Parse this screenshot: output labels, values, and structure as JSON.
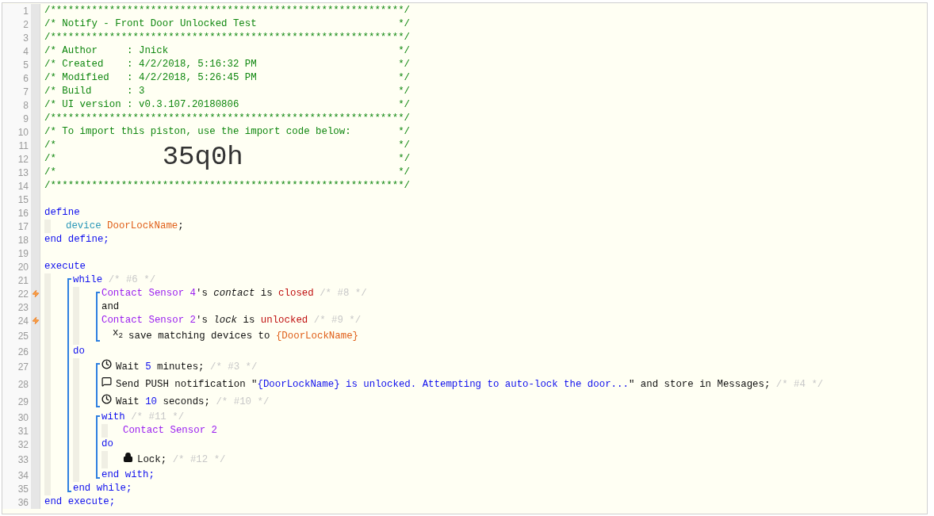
{
  "editor": {
    "lines": [
      {
        "kind": "code",
        "number": "1",
        "trigger": false,
        "tokens": [
          {
            "kind": "comment",
            "text": "/************************************************************/"
          }
        ]
      },
      {
        "kind": "box",
        "number": "2",
        "trigger": false,
        "tokens": [
          {
            "kind": "comment",
            "text": "/* Notify - Front Door Unlocked Test"
          },
          {
            "kind": "comment",
            "text": "*/"
          }
        ]
      },
      {
        "kind": "code",
        "number": "3",
        "trigger": false,
        "tokens": [
          {
            "kind": "comment",
            "text": "/************************************************************/"
          }
        ]
      },
      {
        "kind": "box",
        "number": "4",
        "trigger": false,
        "tokens": [
          {
            "kind": "comment",
            "text": "/* Author     : Jnick"
          },
          {
            "kind": "comment",
            "text": "*/"
          }
        ]
      },
      {
        "kind": "box",
        "number": "5",
        "trigger": false,
        "tokens": [
          {
            "kind": "comment",
            "text": "/* Created    : 4/2/2018, 5:16:32 PM"
          },
          {
            "kind": "comment",
            "text": "*/"
          }
        ]
      },
      {
        "kind": "box",
        "number": "6",
        "trigger": false,
        "tokens": [
          {
            "kind": "comment",
            "text": "/* Modified   : 4/2/2018, 5:26:45 PM"
          },
          {
            "kind": "comment",
            "text": "*/"
          }
        ]
      },
      {
        "kind": "box",
        "number": "7",
        "trigger": false,
        "tokens": [
          {
            "kind": "comment",
            "text": "/* Build      : 3"
          },
          {
            "kind": "comment",
            "text": "*/"
          }
        ]
      },
      {
        "kind": "box",
        "number": "8",
        "trigger": false,
        "tokens": [
          {
            "kind": "comment",
            "text": "/* UI version : v0.3.107.20180806"
          },
          {
            "kind": "comment",
            "text": "*/"
          }
        ]
      },
      {
        "kind": "code",
        "number": "9",
        "trigger": false,
        "tokens": [
          {
            "kind": "comment",
            "text": "/************************************************************/"
          }
        ]
      },
      {
        "kind": "box",
        "number": "10",
        "trigger": false,
        "tokens": [
          {
            "kind": "comment",
            "text": "/* To import this piston, use the import code below:"
          },
          {
            "kind": "comment",
            "text": "*/"
          }
        ]
      },
      {
        "kind": "box",
        "number": "11",
        "trigger": false,
        "tokens": [
          {
            "kind": "comment",
            "text": "/*"
          },
          {
            "kind": "comment",
            "text": "*/"
          }
        ]
      },
      {
        "kind": "box",
        "number": "12",
        "trigger": false,
        "tokens": [
          {
            "kind": "comment",
            "text": "/*"
          },
          {
            "kind": "import_code",
            "text": "35q0h"
          },
          {
            "kind": "comment",
            "text": "*/"
          }
        ]
      },
      {
        "kind": "box",
        "number": "13",
        "trigger": false,
        "tokens": [
          {
            "kind": "comment",
            "text": "/*"
          },
          {
            "kind": "comment",
            "text": "*/"
          }
        ]
      },
      {
        "kind": "code",
        "number": "14",
        "trigger": false,
        "tokens": [
          {
            "kind": "comment",
            "text": "/************************************************************/"
          }
        ]
      },
      {
        "kind": "code",
        "number": "15",
        "trigger": false
      },
      {
        "kind": "code",
        "number": "16",
        "trigger": false,
        "tokens": [
          {
            "kind": "keyword",
            "text": "define"
          }
        ]
      },
      {
        "kind": "indent",
        "children": [
          {
            "kind": "code",
            "number": "17",
            "trigger": false,
            "tokens": [
              {
                "kind": "type",
                "text": "device "
              },
              {
                "kind": "variable",
                "text": "DoorLockName"
              },
              {
                "kind": "plain",
                "text": ";"
              }
            ]
          }
        ]
      },
      {
        "kind": "code",
        "number": "18",
        "trigger": false,
        "tokens": [
          {
            "kind": "keyword",
            "text": "end define;"
          }
        ]
      },
      {
        "kind": "code",
        "number": "19",
        "trigger": false
      },
      {
        "kind": "code",
        "number": "20",
        "trigger": false,
        "tokens": [
          {
            "kind": "keyword",
            "text": "execute"
          }
        ]
      },
      {
        "kind": "indent",
        "children": [
          {
            "kind": "bracket",
            "children": [
              {
                "kind": "code",
                "number": "21",
                "trigger": false,
                "tokens": [
                  {
                    "kind": "keyword",
                    "text": "while "
                  },
                  {
                    "kind": "ref",
                    "text": "/* #6 */"
                  }
                ]
              },
              {
                "kind": "indent",
                "children": [
                  {
                    "kind": "bracket",
                    "children": [
                      {
                        "kind": "code",
                        "number": "22",
                        "trigger": true,
                        "tokens": [
                          {
                            "kind": "device",
                            "text": "Contact Sensor 4"
                          },
                          {
                            "kind": "plain",
                            "text": "'s "
                          },
                          {
                            "kind": "attribute",
                            "text": "contact"
                          },
                          {
                            "kind": "plain",
                            "text": " is "
                          },
                          {
                            "kind": "value",
                            "text": "closed"
                          },
                          {
                            "kind": "ref",
                            "text": " /* #8 */"
                          }
                        ]
                      },
                      {
                        "kind": "code",
                        "number": "23",
                        "trigger": false,
                        "tokens": [
                          {
                            "kind": "plain",
                            "text": "and"
                          }
                        ]
                      },
                      {
                        "kind": "code",
                        "number": "24",
                        "trigger": true,
                        "tokens": [
                          {
                            "kind": "device",
                            "text": "Contact Sensor 2"
                          },
                          {
                            "kind": "plain",
                            "text": "'s "
                          },
                          {
                            "kind": "attribute",
                            "text": "lock"
                          },
                          {
                            "kind": "plain",
                            "text": " is "
                          },
                          {
                            "kind": "value",
                            "text": "unlocked"
                          },
                          {
                            "kind": "ref",
                            "text": " /* #9 */"
                          }
                        ]
                      },
                      {
                        "kind": "save",
                        "number": "25",
                        "trigger": false,
                        "tokens": [
                          {
                            "kind": "glyph",
                            "text": "x$_{2}$"
                          },
                          {
                            "kind": "plain",
                            "text": "save matching devices to "
                          },
                          {
                            "kind": "variable",
                            "text": "{DoorLockName}"
                          }
                        ]
                      }
                    ]
                  }
                ]
              },
              {
                "kind": "code",
                "number": "26",
                "trigger": false,
                "tokens": [
                  {
                    "kind": "keyword",
                    "text": "do"
                  }
                ]
              },
              {
                "kind": "indent",
                "children": [
                  {
                    "kind": "bracket",
                    "children": [
                      {
                        "kind": "wait",
                        "number": "27",
                        "trigger": false,
                        "tokens": [
                          {
                            "kind": "plain",
                            "text": "Wait "
                          },
                          {
                            "kind": "number",
                            "text": "5"
                          },
                          {
                            "kind": "plain",
                            "text": " minutes; "
                          },
                          {
                            "kind": "ref",
                            "text": "/* #3 */"
                          }
                        ]
                      },
                      {
                        "kind": "notify",
                        "number": "28",
                        "trigger": false,
                        "tokens": [
                          {
                            "kind": "plain",
                            "text": "Send PUSH notification \""
                          },
                          {
                            "kind": "string",
                            "text": "{DoorLockName} is unlocked. Attempting to auto-lock the door..."
                          },
                          {
                            "kind": "plain",
                            "text": "\" and store in Messages; "
                          },
                          {
                            "kind": "ref",
                            "text": "/* #4 */"
                          }
                        ]
                      },
                      {
                        "kind": "wait",
                        "number": "29",
                        "trigger": false,
                        "tokens": [
                          {
                            "kind": "plain",
                            "text": "Wait "
                          },
                          {
                            "kind": "number",
                            "text": "10"
                          },
                          {
                            "kind": "plain",
                            "text": " seconds; "
                          },
                          {
                            "kind": "ref",
                            "text": "/* #10 */"
                          }
                        ]
                      }
                    ]
                  },
                  {
                    "kind": "bracket",
                    "children": [
                      {
                        "kind": "code",
                        "number": "30",
                        "trigger": false,
                        "tokens": [
                          {
                            "kind": "keyword",
                            "text": "with "
                          },
                          {
                            "kind": "ref",
                            "text": "/* #11 */"
                          }
                        ]
                      },
                      {
                        "kind": "indent",
                        "children": [
                          {
                            "kind": "code",
                            "number": "31",
                            "trigger": false,
                            "tokens": [
                              {
                                "kind": "device",
                                "text": "Contact Sensor 2"
                              }
                            ]
                          }
                        ]
                      },
                      {
                        "kind": "code",
                        "number": "32",
                        "trigger": false,
                        "tokens": [
                          {
                            "kind": "keyword",
                            "text": "do"
                          }
                        ]
                      },
                      {
                        "kind": "indent",
                        "children": [
                          {
                            "kind": "command",
                            "number": "33",
                            "trigger": false,
                            "tokens": [
                              {
                                "kind": "plain",
                                "text": "Lock; "
                              },
                              {
                                "kind": "ref",
                                "text": "/* #12 */"
                              }
                            ]
                          }
                        ]
                      },
                      {
                        "kind": "code",
                        "number": "34",
                        "trigger": false,
                        "tokens": [
                          {
                            "kind": "keyword",
                            "text": "end with;"
                          }
                        ]
                      }
                    ]
                  }
                ]
              },
              {
                "kind": "code",
                "number": "35",
                "trigger": false,
                "tokens": [
                  {
                    "kind": "keyword",
                    "text": "end while;"
                  }
                ]
              }
            ]
          }
        ]
      },
      {
        "kind": "code",
        "number": "36",
        "trigger": false,
        "tokens": [
          {
            "kind": "keyword",
            "text": "end execute;"
          }
        ]
      }
    ]
  }
}
